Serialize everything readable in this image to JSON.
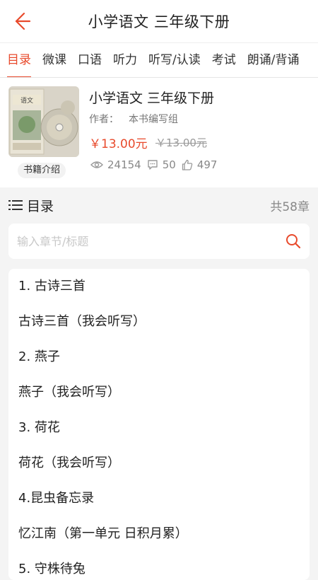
{
  "header": {
    "title": "小学语文  三年级下册"
  },
  "tabs": [
    "目录",
    "微课",
    "口语",
    "听力",
    "听写/认读",
    "考试",
    "朗诵/背诵"
  ],
  "book": {
    "title": "小学语文  三年级下册",
    "author_label": "作者：",
    "author": "本书编写组",
    "price": "￥13.00元",
    "old_price": "￥13.00元",
    "intro_label": "书籍介绍",
    "cover_text": "语文",
    "views": "24154",
    "comments": "50",
    "likes": "497"
  },
  "toc": {
    "title": "目录",
    "count": "共58章",
    "search_placeholder": "输入章节/标题",
    "chapters": [
      "1. 古诗三首",
      "古诗三首（我会听写）",
      "2. 燕子",
      "燕子（我会听写）",
      "3. 荷花",
      "荷花（我会听写）",
      "4.昆虫备忘录",
      "忆江南（第一单元 日积月累）",
      "5. 守株待兔"
    ]
  },
  "colors": {
    "accent": "#e84a2c"
  }
}
